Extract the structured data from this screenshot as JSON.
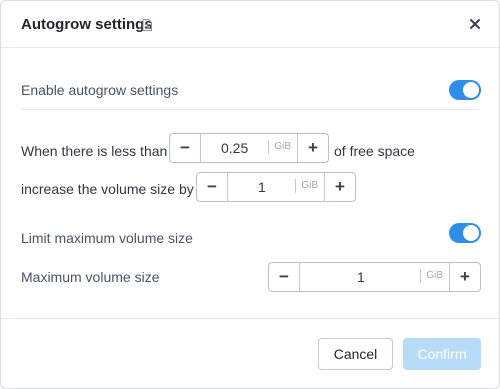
{
  "dialog": {
    "title": "Autogrow settings",
    "close_icon": "close-icon",
    "doc_icon": "document-icon"
  },
  "enable_autogrow": {
    "label": "Enable autogrow settings",
    "enabled": true
  },
  "threshold": {
    "prefix": "When there is less than",
    "value": "0.25",
    "unit": "GiB",
    "suffix": "of free space"
  },
  "increase": {
    "prefix": "increase the volume size by",
    "value": "1",
    "unit": "GiB"
  },
  "limit": {
    "label": "Limit maximum volume size",
    "enabled": true
  },
  "max_size": {
    "label": "Maximum volume size",
    "value": "1",
    "unit": "GiB"
  },
  "footer": {
    "cancel_label": "Cancel",
    "confirm_label": "Confirm"
  },
  "colors": {
    "toggle_on": "#2f8fe8",
    "confirm_disabled": "#b8dbf8"
  }
}
